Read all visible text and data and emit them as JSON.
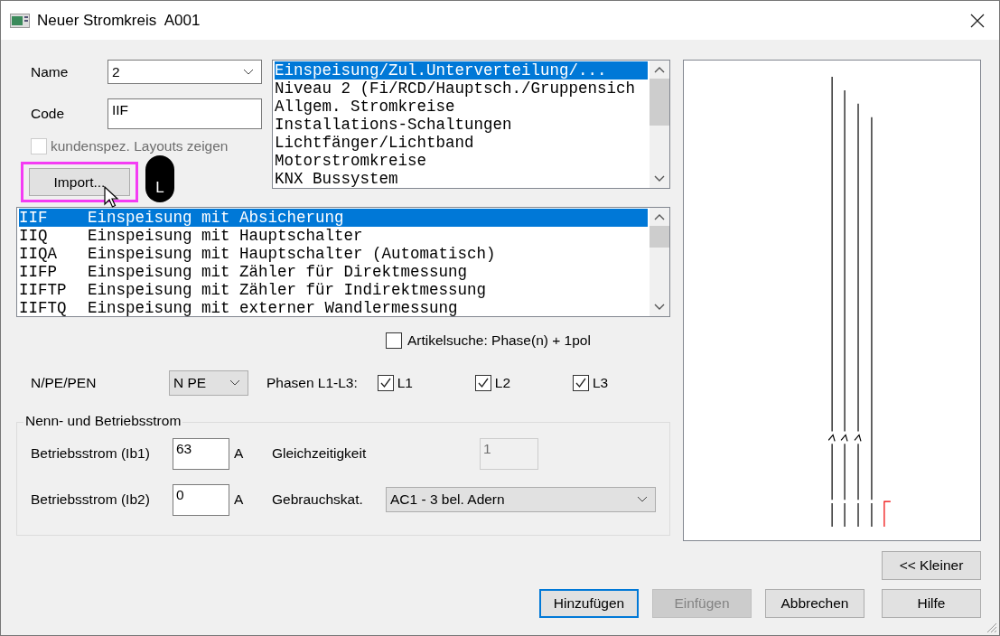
{
  "window": {
    "title": "Neuer Stromkreis  A001"
  },
  "name": {
    "label": "Name",
    "value": "2"
  },
  "code": {
    "label": "Code",
    "value": "IIF"
  },
  "custom_layouts": {
    "label": "kundenspez. Layouts zeigen",
    "checked": false,
    "disabled": true
  },
  "import_button": {
    "label": "Import...",
    "highlighted": true
  },
  "mouse_overlay": {
    "button_label": "L"
  },
  "categories": [
    {
      "label": "Einspeisung/Zul.Unterverteilung/...",
      "selected": true
    },
    {
      "label": "Niveau 2 (Fi/RCD/Hauptsch./Gruppensich",
      "selected": false
    },
    {
      "label": "Allgem. Stromkreise",
      "selected": false
    },
    {
      "label": "Installations-Schaltungen",
      "selected": false
    },
    {
      "label": "Lichtfänger/Lichtband",
      "selected": false
    },
    {
      "label": "Motorstromkreise",
      "selected": false
    },
    {
      "label": "KNX Bussystem",
      "selected": false
    }
  ],
  "circuits": [
    {
      "code": "IIF",
      "description": "Einspeisung mit Absicherung",
      "selected": true
    },
    {
      "code": "IIQ",
      "description": "Einspeisung mit Hauptschalter",
      "selected": false
    },
    {
      "code": "IIQA",
      "description": "Einspeisung mit Hauptschalter (Automatisch)",
      "selected": false
    },
    {
      "code": "IIFP",
      "description": "Einspeisung mit Zähler für Direktmessung",
      "selected": false
    },
    {
      "code": "IIFTP",
      "description": "Einspeisung mit Zähler für Indirektmessung",
      "selected": false
    },
    {
      "code": "IIFTQ",
      "description": "Einspeisung mit externer Wandlermessung",
      "selected": false
    }
  ],
  "article_search": {
    "label": "Artikelsuche: Phase(n) + 1pol",
    "checked": false
  },
  "npe": {
    "label": "N/PE/PEN",
    "value": "N PE"
  },
  "phases": {
    "label": "Phasen L1-L3:",
    "items": [
      {
        "label": "L1",
        "checked": true
      },
      {
        "label": "L2",
        "checked": true
      },
      {
        "label": "L3",
        "checked": true
      }
    ]
  },
  "current_group": {
    "title": "Nenn- und Betriebsstrom",
    "ib1": {
      "label": "Betriebsstrom (Ib1)",
      "value": "63",
      "unit": "A"
    },
    "ib2": {
      "label": "Betriebsstrom (Ib2)",
      "value": "0",
      "unit": "A"
    },
    "simultaneity": {
      "label": "Gleichzeitigkeit",
      "value": "1",
      "disabled": true
    },
    "usage_category": {
      "label": "Gebrauchskat.",
      "value": "AC1 - 3 bel. Adern"
    }
  },
  "smaller_button": {
    "label": "<< Kleiner"
  },
  "buttons": [
    {
      "label": "Hinzufügen",
      "default": true,
      "disabled": false
    },
    {
      "label": "Einfügen",
      "default": false,
      "disabled": true
    },
    {
      "label": "Abbrechen",
      "default": false,
      "disabled": false
    },
    {
      "label": "Hilfe",
      "default": false,
      "disabled": false
    }
  ]
}
